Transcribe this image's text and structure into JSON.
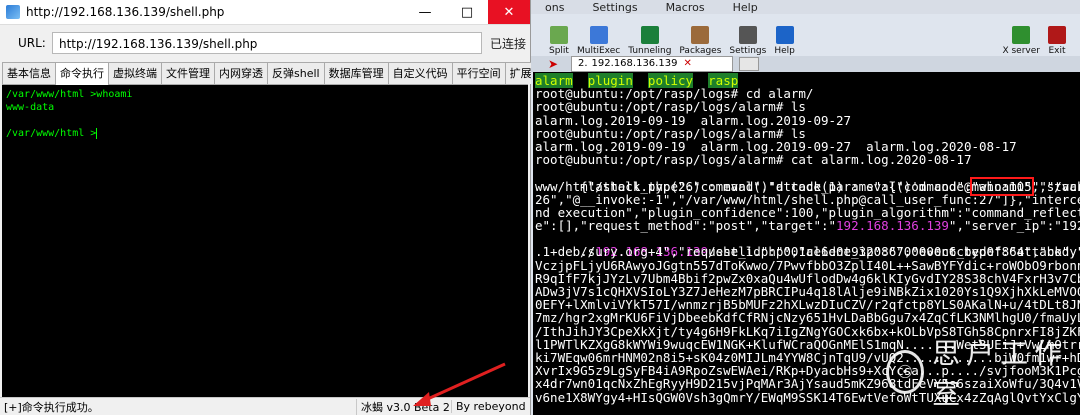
{
  "left": {
    "title": "http://192.168.136.139/shell.php",
    "url_label": "URL:",
    "url_value": "http://192.168.136.139/shell.php",
    "url_status": "已连接",
    "tabs": [
      {
        "label": "基本信息",
        "active": false
      },
      {
        "label": "命令执行",
        "active": true
      },
      {
        "label": "虚拟终端",
        "active": false
      },
      {
        "label": "文件管理",
        "active": false
      },
      {
        "label": "内网穿透",
        "active": false
      },
      {
        "label": "反弹shell",
        "active": false
      },
      {
        "label": "数据库管理",
        "active": false
      },
      {
        "label": "自定义代码",
        "active": false
      },
      {
        "label": "平行空间",
        "active": false
      },
      {
        "label": "扩展功",
        "active": false
      }
    ],
    "terminal_lines": [
      "/var/www/html >whoami",
      "www-data",
      "",
      "/var/www/html >"
    ],
    "status": {
      "message": "[+]命令执行成功。",
      "version": "冰蝎 v3.0 Beta 2",
      "author": "By rebeyond"
    }
  },
  "right": {
    "menu": [
      "ons",
      "Settings",
      "Macros",
      "Help"
    ],
    "toolbar": [
      {
        "label": "Split",
        "icon": "split-icon",
        "color": "#6aa84f"
      },
      {
        "label": "MultiExec",
        "icon": "multiexec-icon",
        "color": "#3c78d8"
      },
      {
        "label": "Tunneling",
        "icon": "tunneling-icon",
        "color": "#1b7f3b"
      },
      {
        "label": "Packages",
        "icon": "packages-icon",
        "color": "#9b6a3b"
      },
      {
        "label": "Settings",
        "icon": "settings-icon",
        "color": "#555555"
      },
      {
        "label": "Help",
        "icon": "help-icon",
        "color": "#1c64c8"
      }
    ],
    "toolbar_right": [
      {
        "label": "X server",
        "icon": "x-server-icon",
        "color": "#2f8f2f"
      },
      {
        "label": "Exit",
        "icon": "exit-icon",
        "color": "#b01818"
      }
    ],
    "session_tab": {
      "number": "2.",
      "label": "192.168.136.139"
    },
    "terminal": {
      "dirs": [
        "alarm",
        "plugin",
        "policy",
        "rasp"
      ],
      "lines": [
        "root@ubuntu:/opt/rasp/logs# cd alarm/",
        "root@ubuntu:/opt/rasp/logs/alarm# ls",
        "alarm.log.2019-09-19  alarm.log.2019-09-27",
        "root@ubuntu:/opt/rasp/logs/alarm# ls",
        "alarm.log.2019-09-19  alarm.log.2019-09-27  alarm.log.2020-08-17",
        "root@ubuntu:/opt/rasp/logs/alarm# cat alarm.log.2020-08-17"
      ],
      "json_pre": "{\"attack_type\":\"command\",\"attack_params\":{\"command\":",
      "json_boxed": "\"whoami\"",
      "json_post": ",\"stack\":[\"/var/www/",
      "body_lines": [
        "www/html/shell.php(26) : eval()'d code(1) : eval()'d code@main:105\",\"/var/www/h",
        "26\",\"@__invoke:-1\",\"/var/www/html/shell.php@call_user_func:27\"]},\"intercept_stat",
        "nd execution\",\"plugin_confidence\":100,\"plugin_algorithm\":\"command_reflect\",\"plug",
        "e\":[],\"request_method\":\"post\",\"target\":\"192.168.136.139\",\"server_ip\":\"192.168.13"
      ],
      "ip_line_pre": "//",
      "ip_line_ip": "192.168.136.139",
      "ip_line_post": "/shell.php\",\"client_ip\":\"\",\"event_type\":\"attack\",\"server_hostna",
      "tail_lines": [
        ".1+deb.sury.org+4\",\"request_id\":\"001ae6d0e932086700000c6cbed0f864\",\"body\":\"3Mnly",
        "VczjpFLjyU6RAwyoJGgtn557dToKwwo/7PwvfbbO3ZplI40L++SawBYFYdic+roWObO9rbonnTa52P57",
        "R9qIfF7kjJYzLv7Ubm4Bbif2pwZx0xaQu4wUflodDw4g6klKIyGvdIY28S38chV4FxrH3v7Cbi+CBUc",
        "ADw3jV7s1cQHXVSIoLY3Z7JeHezM7pBRCIPu4q18lAlje9iNBkZix1020Ys1Q9XjhXkLeMVO0CmlPrAm",
        "0EFY+lXmlviVYkT57I/wnmzrjB5bMUFz2hXLwzDIuCZV/r2qfctp8YLS0AKalN+u/4tDLt8JNBcSjuM/",
        "7mz/hgr2xgMrKU6FiVjDbeebKdfCfRNjcNzy651HvLDaBbGgu7x4ZqCfLK3NMlhgU0/fmaUyL0b1jxUs",
        "/IthJihJY3CpeXkXjt/ty4g6H9FkLKq7iIgZNgYGOCxk6bx+kOLbVpS8TGh58CpnrxFI8jZKF0qlgpDr",
        "l1PWTlKZXgG8kWYWi9wuqcEW1NGK+KlufWCraQOGnMElS1mqN.......Wet3UEiJ+VwLmOtrraDGlwQApAz",
        "ki7WEqw06mrHNM02n8i5+sK04z0MIJLm4YYW8CjnTqU9/vUQ2............bjW0fm1wr+hDF+wcgwi5",
        "XvrIx9G5z9LgSyFB4iA9RpoZswEWAei/RKp+DyacbHs9+XcYcsa...p..../svjfooM3K1PcgqNTLeUs",
        "x4dr7wn01qcNxZhEgRyyH9D215vjPqMAr3AjYsaud5mKZ968tdFeVY5s6szaiXoWfu/3Q4v1VVWppfO",
        "v6ne1X8WYgy4+HIsQGW0Vsh3gQmrY/EWqM9SSK14T6EwtVefoWtTUXuCx4zZqAglQvtYxClgY5dV8Au5"
      ]
    },
    "watermark": "思户工作室"
  }
}
